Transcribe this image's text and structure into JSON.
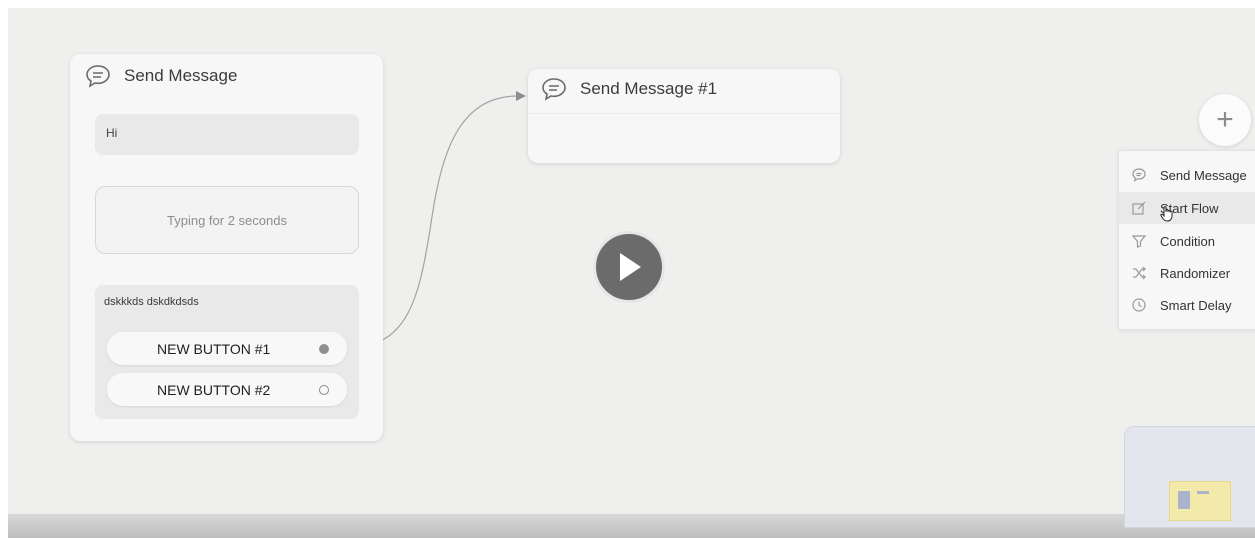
{
  "node1": {
    "title": "Send Message",
    "text_block": "Hi",
    "typing": "Typing for 2 seconds",
    "card_text": "dskkkds dskdkdsds",
    "buttons": [
      {
        "label": "NEW BUTTON #1",
        "connected": true
      },
      {
        "label": "NEW BUTTON #2",
        "connected": false
      }
    ]
  },
  "node2": {
    "title": "Send Message #1"
  },
  "add_button": {
    "symbol": "+"
  },
  "menu": {
    "items": [
      {
        "label": "Send Message",
        "icon": "chat-icon"
      },
      {
        "label": "Start Flow",
        "icon": "edit-icon"
      },
      {
        "label": "Condition",
        "icon": "filter-icon"
      },
      {
        "label": "Randomizer",
        "icon": "shuffle-icon"
      },
      {
        "label": "Smart Delay",
        "icon": "clock-icon"
      }
    ]
  },
  "colors": {
    "canvas": "#efefee",
    "connector": "#9a9a9a",
    "play_button": "#6b6b6b",
    "minimap": "#e4e6ee",
    "minimap_node": "#f3e9a8"
  }
}
